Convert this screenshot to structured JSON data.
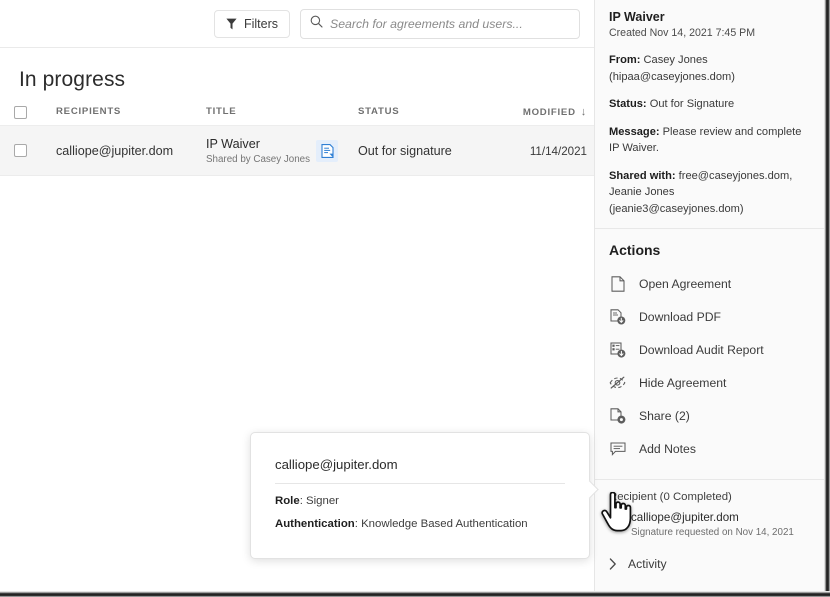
{
  "toolbar": {
    "filters_label": "Filters",
    "filter_icon": "funnel-icon",
    "search_placeholder": "Search for agreements and users...",
    "search_value": "",
    "search_icon": "search-icon"
  },
  "list": {
    "section_title": "In progress",
    "columns": [
      "RECIPIENTS",
      "TITLE",
      "STATUS",
      "MODIFIED"
    ],
    "sort_indicator": "↓",
    "rows": [
      {
        "recipient": "calliope@jupiter.dom",
        "title": "IP Waiver",
        "shared_by": "Shared by Casey Jones",
        "doc_icon": "agreement-document-icon",
        "status": "Out for signature",
        "modified": "11/14/2021"
      }
    ]
  },
  "detail": {
    "title": "IP Waiver",
    "created": "Created Nov 14, 2021 7:45 PM",
    "from_label": "From:",
    "from_value": "Casey Jones (hipaa@caseyjones.dom)",
    "status_label": "Status:",
    "status_value": "Out for Signature",
    "message_label": "Message:",
    "message_value": "Please review and complete IP Waiver.",
    "shared_label": "Shared with:",
    "shared_value": "free@caseyjones.dom, Jeanie Jones (jeanie3@caseyjones.dom)"
  },
  "actions": {
    "heading": "Actions",
    "items": [
      {
        "label": "Open Agreement",
        "icon": "document-icon"
      },
      {
        "label": "Download PDF",
        "icon": "download-pdf-icon"
      },
      {
        "label": "Download Audit Report",
        "icon": "download-audit-report-icon"
      },
      {
        "label": "Hide Agreement",
        "icon": "eye-off-icon"
      },
      {
        "label": "Share (2)",
        "icon": "share-icon"
      },
      {
        "label": "Add Notes",
        "icon": "comment-icon"
      }
    ]
  },
  "recipient_section": {
    "heading": "Recipient (0 Completed)",
    "status_dot_color": "#f08c00",
    "email": "calliope@jupiter.dom",
    "sub": "Signature requested on Nov 14, 2021"
  },
  "activity": {
    "label": "Activity",
    "chevron": "chevron-right-icon"
  },
  "tooltip": {
    "email": "calliope@jupiter.dom",
    "role_label": "Role",
    "role_value": "Signer",
    "auth_label": "Authentication",
    "auth_value": "Knowledge Based Authentication"
  },
  "cursor": {
    "type": "pointing-hand-cursor"
  }
}
